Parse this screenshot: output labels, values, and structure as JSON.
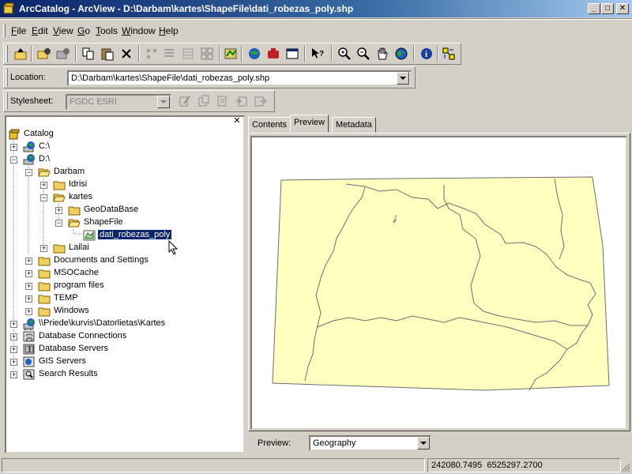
{
  "window": {
    "title": "ArcCatalog - ArcView - D:\\Darbam\\kartes\\ShapeFile\\dati_robezas_poly.shp",
    "minimize_icon": "minimize-icon",
    "maximize_icon": "maximize-icon",
    "close_icon": "close-icon"
  },
  "menu": {
    "items": [
      {
        "u": "F",
        "rest": "ile"
      },
      {
        "u": "E",
        "rest": "dit"
      },
      {
        "u": "V",
        "rest": "iew"
      },
      {
        "u": "G",
        "rest": "o"
      },
      {
        "u": "T",
        "rest": "ools"
      },
      {
        "u": "W",
        "rest": "indow"
      },
      {
        "u": "H",
        "rest": "elp"
      }
    ]
  },
  "toolbar": {
    "buttons": [
      "up-one-level-icon",
      "connect-folder-icon",
      "disconnect-folder-icon",
      "copy-icon",
      "paste-icon",
      "delete-icon",
      "large-icons-icon",
      "list-icon",
      "details-icon",
      "thumbnails-icon",
      "launch-arcmap-icon",
      "arctoolbox-icon",
      "modelbuilder-icon",
      "command-line-icon",
      "whats-this-icon",
      "zoom-in-icon",
      "zoom-out-icon",
      "pan-icon",
      "full-extent-icon",
      "identify-icon",
      "create-thumbnail-icon"
    ]
  },
  "location": {
    "label": "Location:",
    "value": "D:\\Darbam\\kartes\\ShapeFile\\dati_robezas_poly.shp"
  },
  "stylesheet": {
    "label": "Stylesheet:",
    "value": "FGDC ESRI"
  },
  "tree": {
    "close_icon": "close-icon",
    "items": [
      {
        "label": "Catalog"
      },
      {
        "label": "C:\\"
      },
      {
        "label": "D:\\"
      },
      {
        "label": "Darbam"
      },
      {
        "label": "Idrisi"
      },
      {
        "label": "kartes"
      },
      {
        "label": "GeoDataBase"
      },
      {
        "label": "ShapeFile"
      },
      {
        "label": "dati_robezas_poly"
      },
      {
        "label": "Lailai"
      },
      {
        "label": "Documents and Settings"
      },
      {
        "label": "MSOCache"
      },
      {
        "label": "program files"
      },
      {
        "label": "TEMP"
      },
      {
        "label": "Windows"
      },
      {
        "label": "\\\\Priede\\kurvis\\Datorlietas\\Kartes"
      },
      {
        "label": "Database Connections"
      },
      {
        "label": "Database Servers"
      },
      {
        "label": "GIS Servers"
      },
      {
        "label": "Search Results"
      }
    ]
  },
  "tabs": [
    {
      "label": "Contents"
    },
    {
      "label": "Preview"
    },
    {
      "label": "Metadata"
    }
  ],
  "preview": {
    "label": "Preview:",
    "value": "Geography",
    "polygon_fill": "#ffffc0",
    "polygon_stroke": "#6e6e6e"
  },
  "status": {
    "coordinates": "242080.7495  6525297.2700"
  }
}
